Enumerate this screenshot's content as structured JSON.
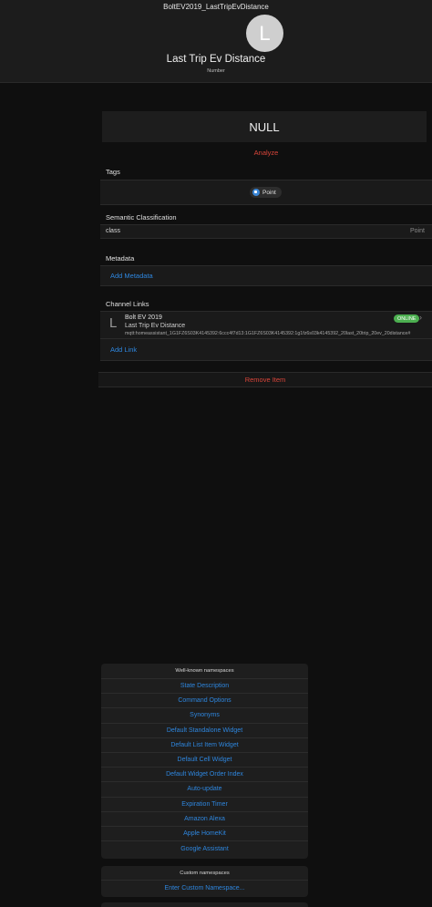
{
  "header": {
    "item_name": "BoltEV2019_LastTripEvDistance",
    "avatar_letter": "L",
    "label": "Last Trip Ev Distance",
    "type": "Number"
  },
  "state": {
    "value": "NULL",
    "analyze_label": "Analyze"
  },
  "tags": {
    "title": "Tags",
    "items": [
      {
        "label": "Point",
        "icon": "tag-icon"
      }
    ]
  },
  "semantic": {
    "title": "Semantic Classification",
    "key": "class",
    "value": "Point"
  },
  "metadata": {
    "title": "Metadata",
    "add_label": "Add Metadata"
  },
  "channel_links": {
    "title": "Channel Links",
    "link": {
      "icon_letter": "L",
      "thing": "Bolt EV 2019",
      "label": "Last Trip Ev Distance",
      "uid": "mqtt:homeassistant_1G1FZ6S03K4145392:6ccc4f7d13:1G1FZ6S03K4145392:1g1fz6s03k4145392_20last_20trip_20ev_20distance#",
      "status": "ONLINE"
    },
    "add_label": "Add Link"
  },
  "remove_label": "Remove Item",
  "namespaces": {
    "title": "Well-known namespaces",
    "items": [
      "State Description",
      "Command Options",
      "Synonyms",
      "Default Standalone Widget",
      "Default List Item Widget",
      "Default Cell Widget",
      "Default Widget Order Index",
      "Auto-update",
      "Expiration Timer",
      "Amazon Alexa",
      "Apple HomeKit",
      "Google Assistant"
    ]
  },
  "custom_namespaces": {
    "title": "Custom namespaces",
    "enter_label": "Enter Custom Namespace..."
  },
  "colors": {
    "accent": "#2e86de",
    "danger": "#d9453a",
    "online": "#4caf50"
  }
}
